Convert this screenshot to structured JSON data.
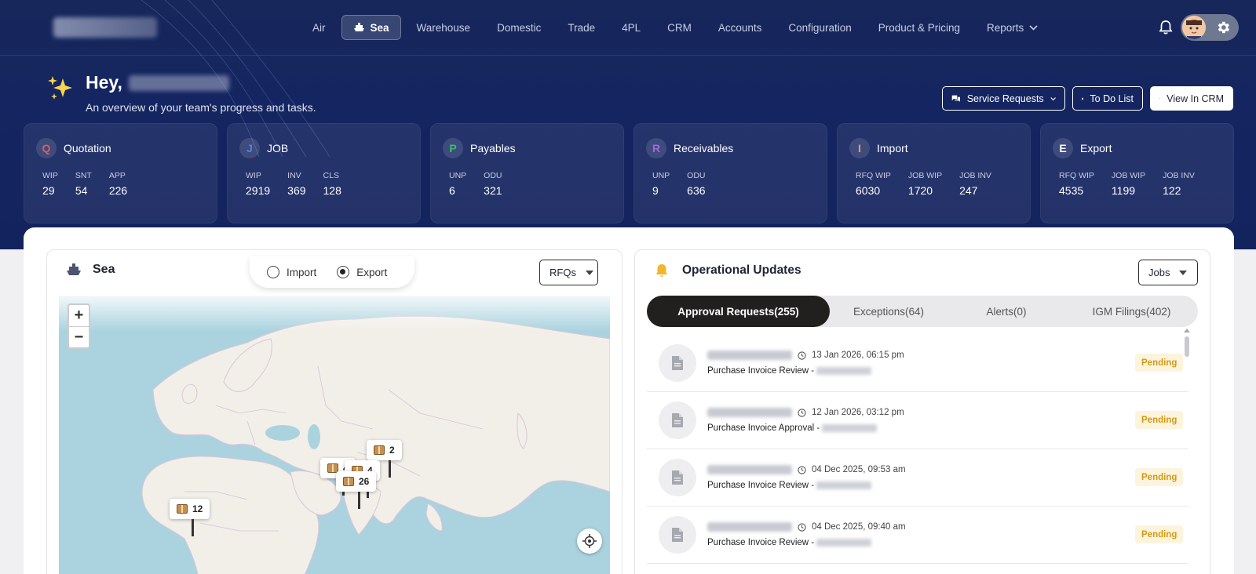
{
  "nav": {
    "items": [
      {
        "label": "Air"
      },
      {
        "label": "Sea",
        "active": true,
        "icon": "ship-icon"
      },
      {
        "label": "Warehouse"
      },
      {
        "label": "Domestic"
      },
      {
        "label": "Trade"
      },
      {
        "label": "4PL"
      },
      {
        "label": "CRM"
      },
      {
        "label": "Accounts"
      },
      {
        "label": "Configuration"
      },
      {
        "label": "Product & Pricing"
      },
      {
        "label": "Reports",
        "dropdown": true
      }
    ]
  },
  "greeting": {
    "title": "Hey,",
    "subtitle": "An overview of your team's progress and tasks."
  },
  "header_buttons": {
    "service_requests": "Service Requests",
    "todo": "To Do List",
    "view_crm": "View In CRM"
  },
  "stats": [
    {
      "letter": "Q",
      "title": "Quotation",
      "color": "#e35b5b",
      "metrics": [
        {
          "label": "WIP",
          "value": "29"
        },
        {
          "label": "SNT",
          "value": "54"
        },
        {
          "label": "APP",
          "value": "226"
        }
      ]
    },
    {
      "letter": "J",
      "title": "JOB",
      "color": "#4a86e8",
      "metrics": [
        {
          "label": "WIP",
          "value": "2919"
        },
        {
          "label": "INV",
          "value": "369"
        },
        {
          "label": "CLS",
          "value": "128"
        }
      ]
    },
    {
      "letter": "P",
      "title": "Payables",
      "color": "#3bbf6a",
      "metrics": [
        {
          "label": "UNP",
          "value": "6"
        },
        {
          "label": "ODU",
          "value": "321"
        }
      ]
    },
    {
      "letter": "R",
      "title": "Receivables",
      "color": "#a566e0",
      "metrics": [
        {
          "label": "UNP",
          "value": "9"
        },
        {
          "label": "ODU",
          "value": "636"
        }
      ]
    },
    {
      "letter": "I",
      "title": "Import",
      "color": "#e7a53b",
      "metrics": [
        {
          "label": "RFQ WIP",
          "value": "6030"
        },
        {
          "label": "JOB WIP",
          "value": "1720"
        },
        {
          "label": "JOB INV",
          "value": "247"
        }
      ]
    },
    {
      "letter": "E",
      "title": "Export",
      "color": "#ffffff",
      "metrics": [
        {
          "label": "RFQ WIP",
          "value": "4535"
        },
        {
          "label": "JOB WIP",
          "value": "1199"
        },
        {
          "label": "JOB INV",
          "value": "122"
        }
      ]
    }
  ],
  "sea_panel": {
    "title": "Sea",
    "radio_import": "Import",
    "radio_export": "Export",
    "selected": "Export",
    "dropdown": "RFQs",
    "zoom_in": "+",
    "zoom_out": "−",
    "markers": [
      {
        "count": "2"
      },
      {
        "count": "4"
      },
      {
        "count": "4"
      },
      {
        "count": "26"
      },
      {
        "count": "12"
      }
    ]
  },
  "ops_panel": {
    "title": "Operational Updates",
    "dropdown": "Jobs",
    "tabs": [
      "Approval Requests(255)",
      "Exceptions(64)",
      "Alerts(0)",
      "IGM Filings(402)"
    ],
    "active_tab": 0,
    "items": [
      {
        "time": "13 Jan 2026, 06:15 pm",
        "desc": "Purchase Invoice Review - ",
        "status": "Pending"
      },
      {
        "time": "12 Jan 2026, 03:12 pm",
        "desc": "Purchase Invoice Approval - ",
        "status": "Pending"
      },
      {
        "time": "04 Dec 2025, 09:53 am",
        "desc": "Purchase Invoice Review - ",
        "status": "Pending"
      },
      {
        "time": "04 Dec 2025, 09:40 am",
        "desc": "Purchase Invoice Review - ",
        "status": "Pending"
      }
    ]
  }
}
